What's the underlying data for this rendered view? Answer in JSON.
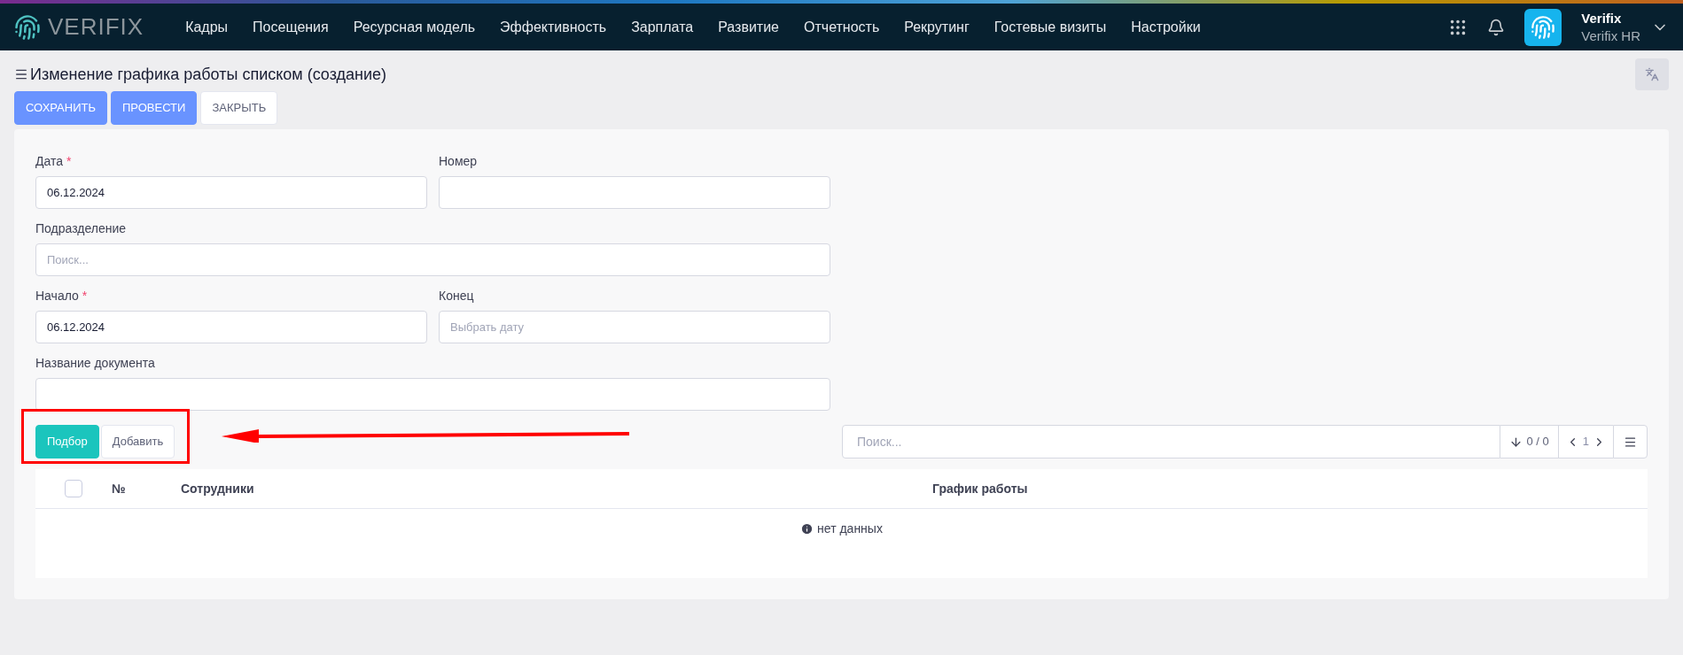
{
  "brand": {
    "logo_text": "VERIFIX"
  },
  "nav": [
    {
      "label": "Кадры"
    },
    {
      "label": "Посещения"
    },
    {
      "label": "Ресурсная модель"
    },
    {
      "label": "Эффективность"
    },
    {
      "label": "Зарплата"
    },
    {
      "label": "Развитие"
    },
    {
      "label": "Отчетность"
    },
    {
      "label": "Рекрутинг"
    },
    {
      "label": "Гостевые визиты"
    },
    {
      "label": "Настройки"
    }
  ],
  "user": {
    "name": "Verifix",
    "company": "Verifix HR"
  },
  "page_title": "Изменение графика работы списком (создание)",
  "actions": [
    {
      "label": "СОХРАНИТЬ",
      "kind": "primary"
    },
    {
      "label": "ПРОВЕСТИ",
      "kind": "primary"
    },
    {
      "label": "ЗАКРЫТЬ",
      "kind": "default"
    }
  ],
  "form_rows": [
    [
      {
        "label": "Дата",
        "required_mark": "*",
        "value": "06.12.2024"
      },
      {
        "label": "Номер"
      }
    ],
    [
      {
        "label": "Подразделение",
        "placeholder": "Поиск..."
      }
    ],
    [
      {
        "label": "Начало",
        "required_mark": "*",
        "value": "06.12.2024"
      },
      {
        "label": "Конец",
        "placeholder": "Выбрать дату"
      }
    ],
    [
      {
        "label": "Название документа"
      }
    ]
  ],
  "table_buttons": [
    {
      "label": "Подбор",
      "kind": "accent"
    },
    {
      "label": "Добавить",
      "kind": "default"
    }
  ],
  "table_search": {
    "placeholder": "Поиск..."
  },
  "table_count": "0 / 0",
  "page_number": "1",
  "table": {
    "select_all_checked": false,
    "columns": [
      "№",
      "Сотрудники",
      "График работы"
    ],
    "empty_text": "нет данных"
  }
}
